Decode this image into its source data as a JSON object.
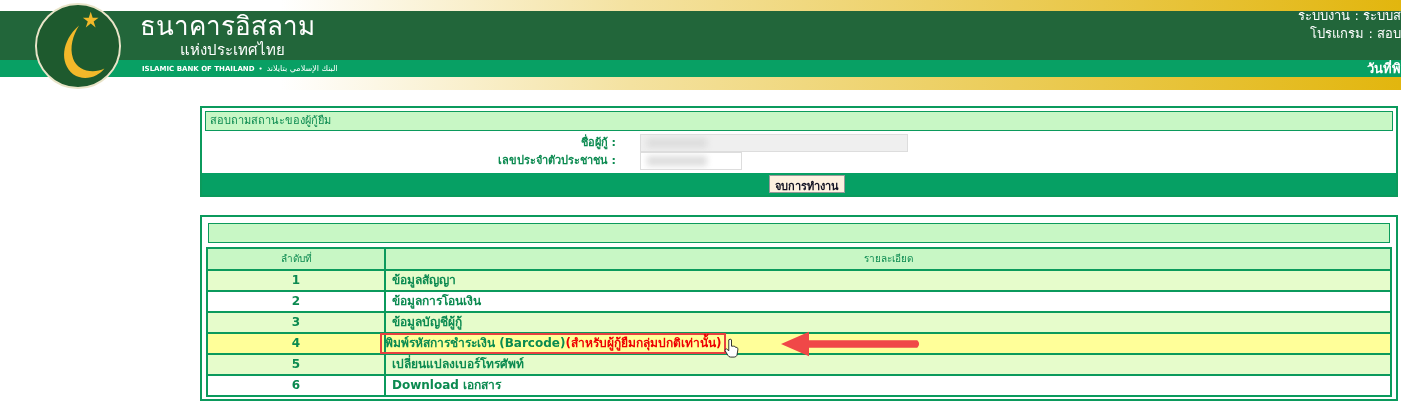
{
  "header": {
    "bank_name": "ธนาคารอิสลาม",
    "bank_subname": "แห่งประเทศไทย",
    "bank_english": "ISLAMIC BANK OF THAILAND",
    "bank_separator": "•",
    "bank_arabic": "البنك الإسلامي بتايلاند",
    "system": "ระบบงาน : ระบบส",
    "program": "โปรแกรม : สอบ",
    "date": "วันที่พิ"
  },
  "inquiry": {
    "title": "สอบถามสถานะของผู้กู้ยืม",
    "fields": [
      {
        "label": "ชื่อผู้กู้ :",
        "kind": "wide"
      },
      {
        "label": "เลขประจำตัวประชาชน :",
        "kind": "narrow"
      }
    ],
    "button": "จบการทำงาน"
  },
  "menu": {
    "columns": [
      "ลำดับที่",
      "รายละเอียด"
    ],
    "rows": [
      {
        "number": "1",
        "text": "ข้อมูลสัญญา",
        "selected": false
      },
      {
        "number": "2",
        "text": "ข้อมูลการโอนเงิน",
        "selected": false
      },
      {
        "number": "3",
        "text": "ข้อมูลบัญชีผู้กู้",
        "selected": false
      },
      {
        "number": "4",
        "text": "พิมพ์รหัสการชำระเงิน (Barcode)",
        "note": "(สำหรับผู้กู้ยืมกลุ่มปกติเท่านั้น)",
        "selected": true
      },
      {
        "number": "5",
        "text": "เปลี่ยนแปลงเบอร์โทรศัพท์",
        "selected": false
      },
      {
        "number": "6",
        "text": "Download เอกสาร",
        "selected": false
      }
    ]
  }
}
